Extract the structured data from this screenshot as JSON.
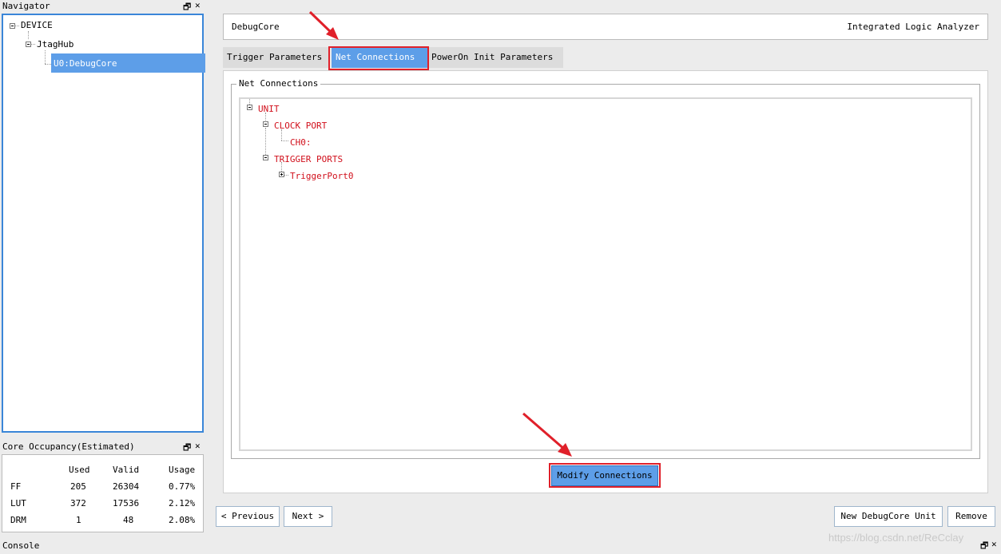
{
  "navigator": {
    "title": "Navigator",
    "tree": {
      "device": "DEVICE",
      "hub": "JtagHub",
      "core": "U0:DebugCore"
    }
  },
  "occupancy": {
    "title": "Core Occupancy(Estimated)",
    "headers": [
      "Used",
      "Valid",
      "Usage"
    ],
    "rows": [
      {
        "name": "FF",
        "used": "205",
        "valid": "26304",
        "usage": "0.77%"
      },
      {
        "name": "LUT",
        "used": "372",
        "valid": "17536",
        "usage": "2.12%"
      },
      {
        "name": "DRM",
        "used": "1",
        "valid": "48",
        "usage": "2.08%"
      }
    ]
  },
  "console": {
    "title": "Console"
  },
  "header": {
    "left": "DebugCore",
    "right": "Integrated Logic Analyzer"
  },
  "tabs": [
    {
      "label": "Trigger Parameters",
      "active": false
    },
    {
      "label": "Net Connections",
      "active": true
    },
    {
      "label": "PowerOn Init Parameters",
      "active": false
    }
  ],
  "net_connections": {
    "group_title": "Net Connections",
    "tree": {
      "unit": "UNIT",
      "clock_port": "CLOCK PORT",
      "ch0": "CH0:",
      "trigger_ports": "TRIGGER PORTS",
      "trigger_port0": "TriggerPort0"
    },
    "modify_button": "Modify Connections"
  },
  "footer": {
    "previous": "< Previous",
    "next": "Next >",
    "new_unit": "New DebugCore Unit",
    "remove": "Remove"
  },
  "watermark": "https://blog.csdn.net/ReCclay",
  "colors": {
    "accent": "#5d9ee8",
    "selection_border": "#3a86d8",
    "annotation": "#e0202a",
    "tree_text": "#d10f1b"
  },
  "icons": [
    "restore-icon",
    "close-icon",
    "expand-icon",
    "collapse-icon",
    "arrow-annotation-icon"
  ]
}
